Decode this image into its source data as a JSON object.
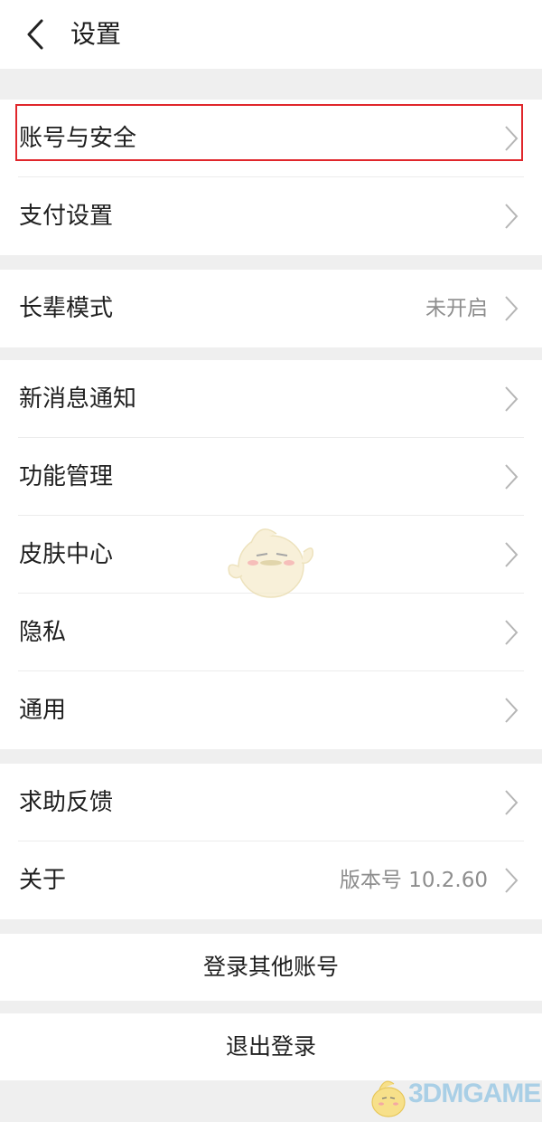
{
  "header": {
    "title": "设置",
    "back_icon": "chevron-left-icon"
  },
  "groups": [
    {
      "items": [
        {
          "label": "账号与安全",
          "highlighted": true
        },
        {
          "label": "支付设置"
        }
      ]
    },
    {
      "items": [
        {
          "label": "长辈模式",
          "value": "未开启"
        }
      ]
    },
    {
      "items": [
        {
          "label": "新消息通知"
        },
        {
          "label": "功能管理"
        },
        {
          "label": "皮肤中心"
        },
        {
          "label": "隐私"
        },
        {
          "label": "通用"
        }
      ]
    },
    {
      "items": [
        {
          "label": "求助反馈"
        },
        {
          "label": "关于",
          "value": "版本号 10.2.60"
        }
      ]
    }
  ],
  "actions": {
    "switch_account": "登录其他账号",
    "logout": "退出登录"
  },
  "watermark": {
    "text": "3DMGAME",
    "color": "#a9cfe6"
  },
  "colors": {
    "highlight_border": "#e0262b",
    "background": "#efefef",
    "secondary_text": "#8d8d8d"
  }
}
